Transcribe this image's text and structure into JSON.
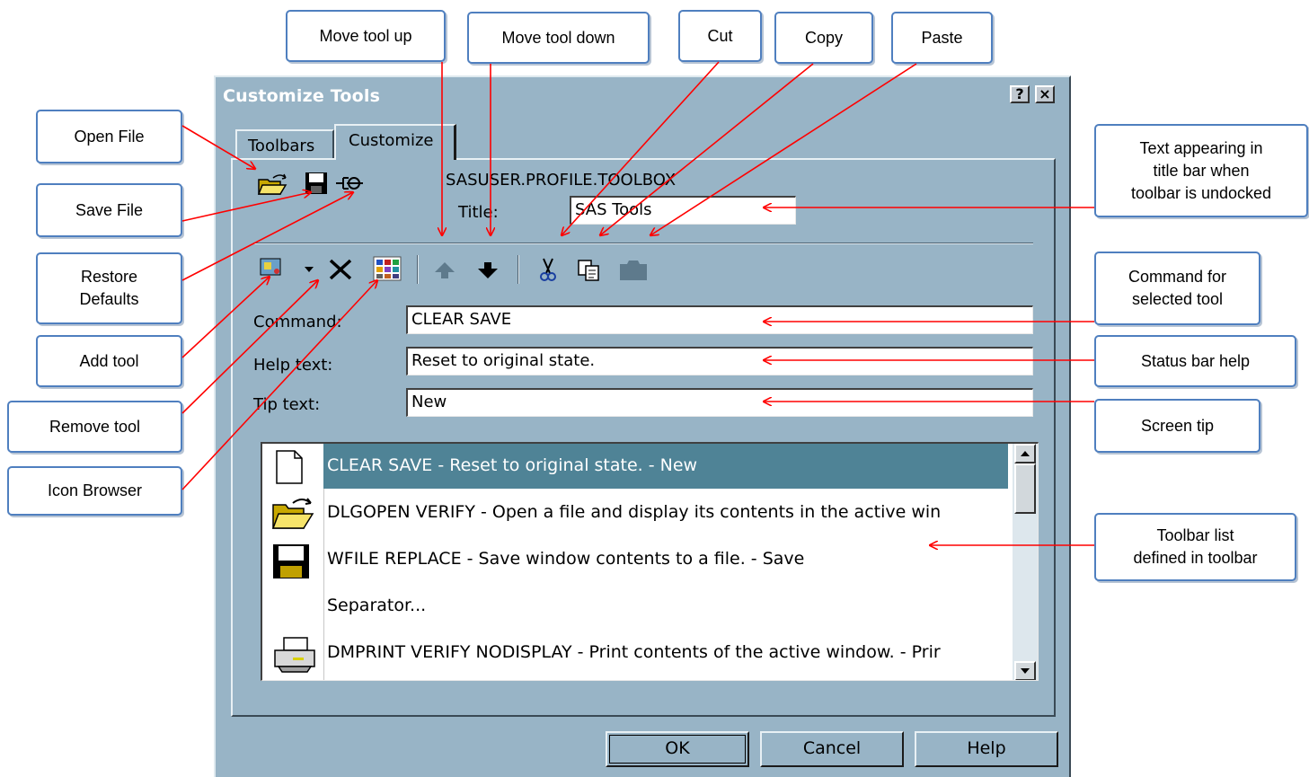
{
  "dialog": {
    "title": "Customize Tools",
    "help_btn": "?",
    "close_btn": "×",
    "tabs": [
      "Toolbars",
      "Customize"
    ],
    "catalog_entry": "SASUSER.PROFILE.TOOLBOX",
    "title_label": "Title:",
    "title_value": "SAS Tools",
    "command_label": "Command:",
    "command_value": "CLEAR SAVE",
    "help_label": "Help text:",
    "help_value": "Reset to original state.",
    "tip_label": "Tip text:",
    "tip_value": "New",
    "tool_list": [
      {
        "icon": "new-document-icon",
        "text": "CLEAR SAVE - Reset to original state. - New",
        "selected": true
      },
      {
        "icon": "open-folder-icon",
        "text": "DLGOPEN VERIFY - Open a file and display its contents in the active win"
      },
      {
        "icon": "floppy-save-icon",
        "text": "WFILE REPLACE - Save window contents to a file. - Save"
      },
      {
        "icon": "",
        "text": "Separator..."
      },
      {
        "icon": "printer-icon",
        "text": "DMPRINT VERIFY NODISPLAY - Print contents of the active window. - Prir"
      }
    ],
    "buttons": {
      "ok": "OK",
      "cancel": "Cancel",
      "help": "Help"
    },
    "colors": {
      "dialog_bg": "#98b4c6",
      "selection": "#4f8396"
    }
  },
  "callouts": {
    "move_up": "Move tool up",
    "move_down": "Move tool down",
    "cut": "Cut",
    "copy": "Copy",
    "paste": "Paste",
    "open_file": "Open File",
    "save_file": "Save File",
    "restore_defaults": "Restore\nDefaults",
    "add_tool": "Add tool",
    "remove_tool": "Remove tool",
    "icon_browser": "Icon Browser",
    "title_text": "Text appearing in\ntitle bar when\ntoolbar is undocked",
    "command": "Command for\nselected tool",
    "status_help": "Status bar help",
    "screen_tip": "Screen tip",
    "toolbar_list": "Toolbar list\ndefined in toolbar"
  }
}
